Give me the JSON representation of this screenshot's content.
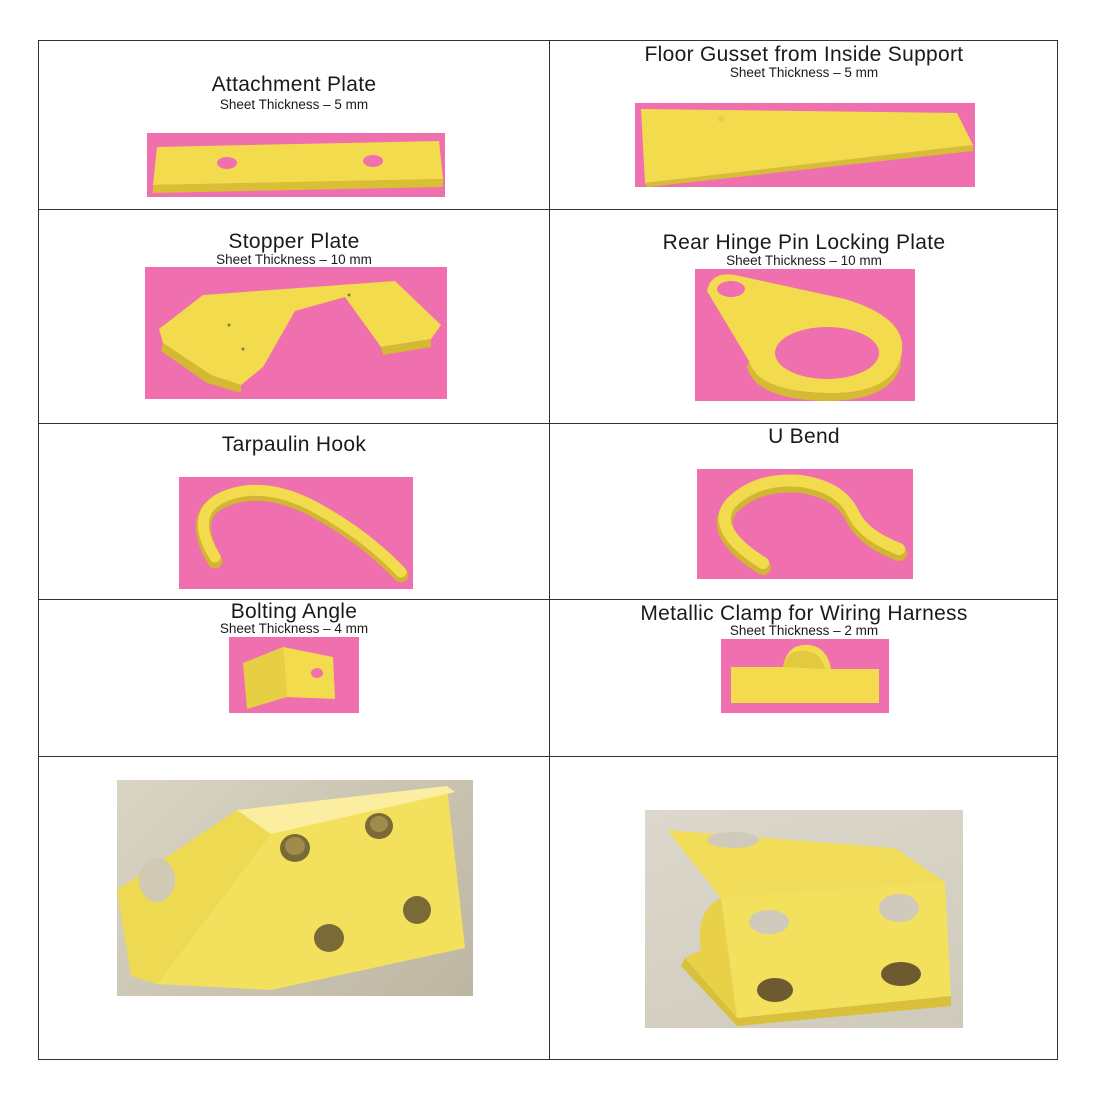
{
  "parts": [
    {
      "title": "Attachment Plate",
      "thickness": "Sheet Thickness – 5 mm"
    },
    {
      "title": "Floor Gusset from Inside Support",
      "thickness": "Sheet Thickness – 5 mm"
    },
    {
      "title": "Stopper Plate",
      "thickness": "Sheet Thickness – 10 mm"
    },
    {
      "title": "Rear Hinge Pin Locking Plate",
      "thickness": "Sheet Thickness – 10 mm"
    },
    {
      "title": "Tarpaulin Hook"
    },
    {
      "title": "U Bend"
    },
    {
      "title": "Bolting Angle",
      "thickness": "Sheet Thickness – 4 mm"
    },
    {
      "title": "Metallic Clamp for Wiring Harness",
      "thickness": "Sheet Thickness – 2 mm"
    }
  ],
  "colors": {
    "part_yellow": "#f2dc4e",
    "backdrop_pink": "#f06fae",
    "grid_line": "#333333"
  }
}
